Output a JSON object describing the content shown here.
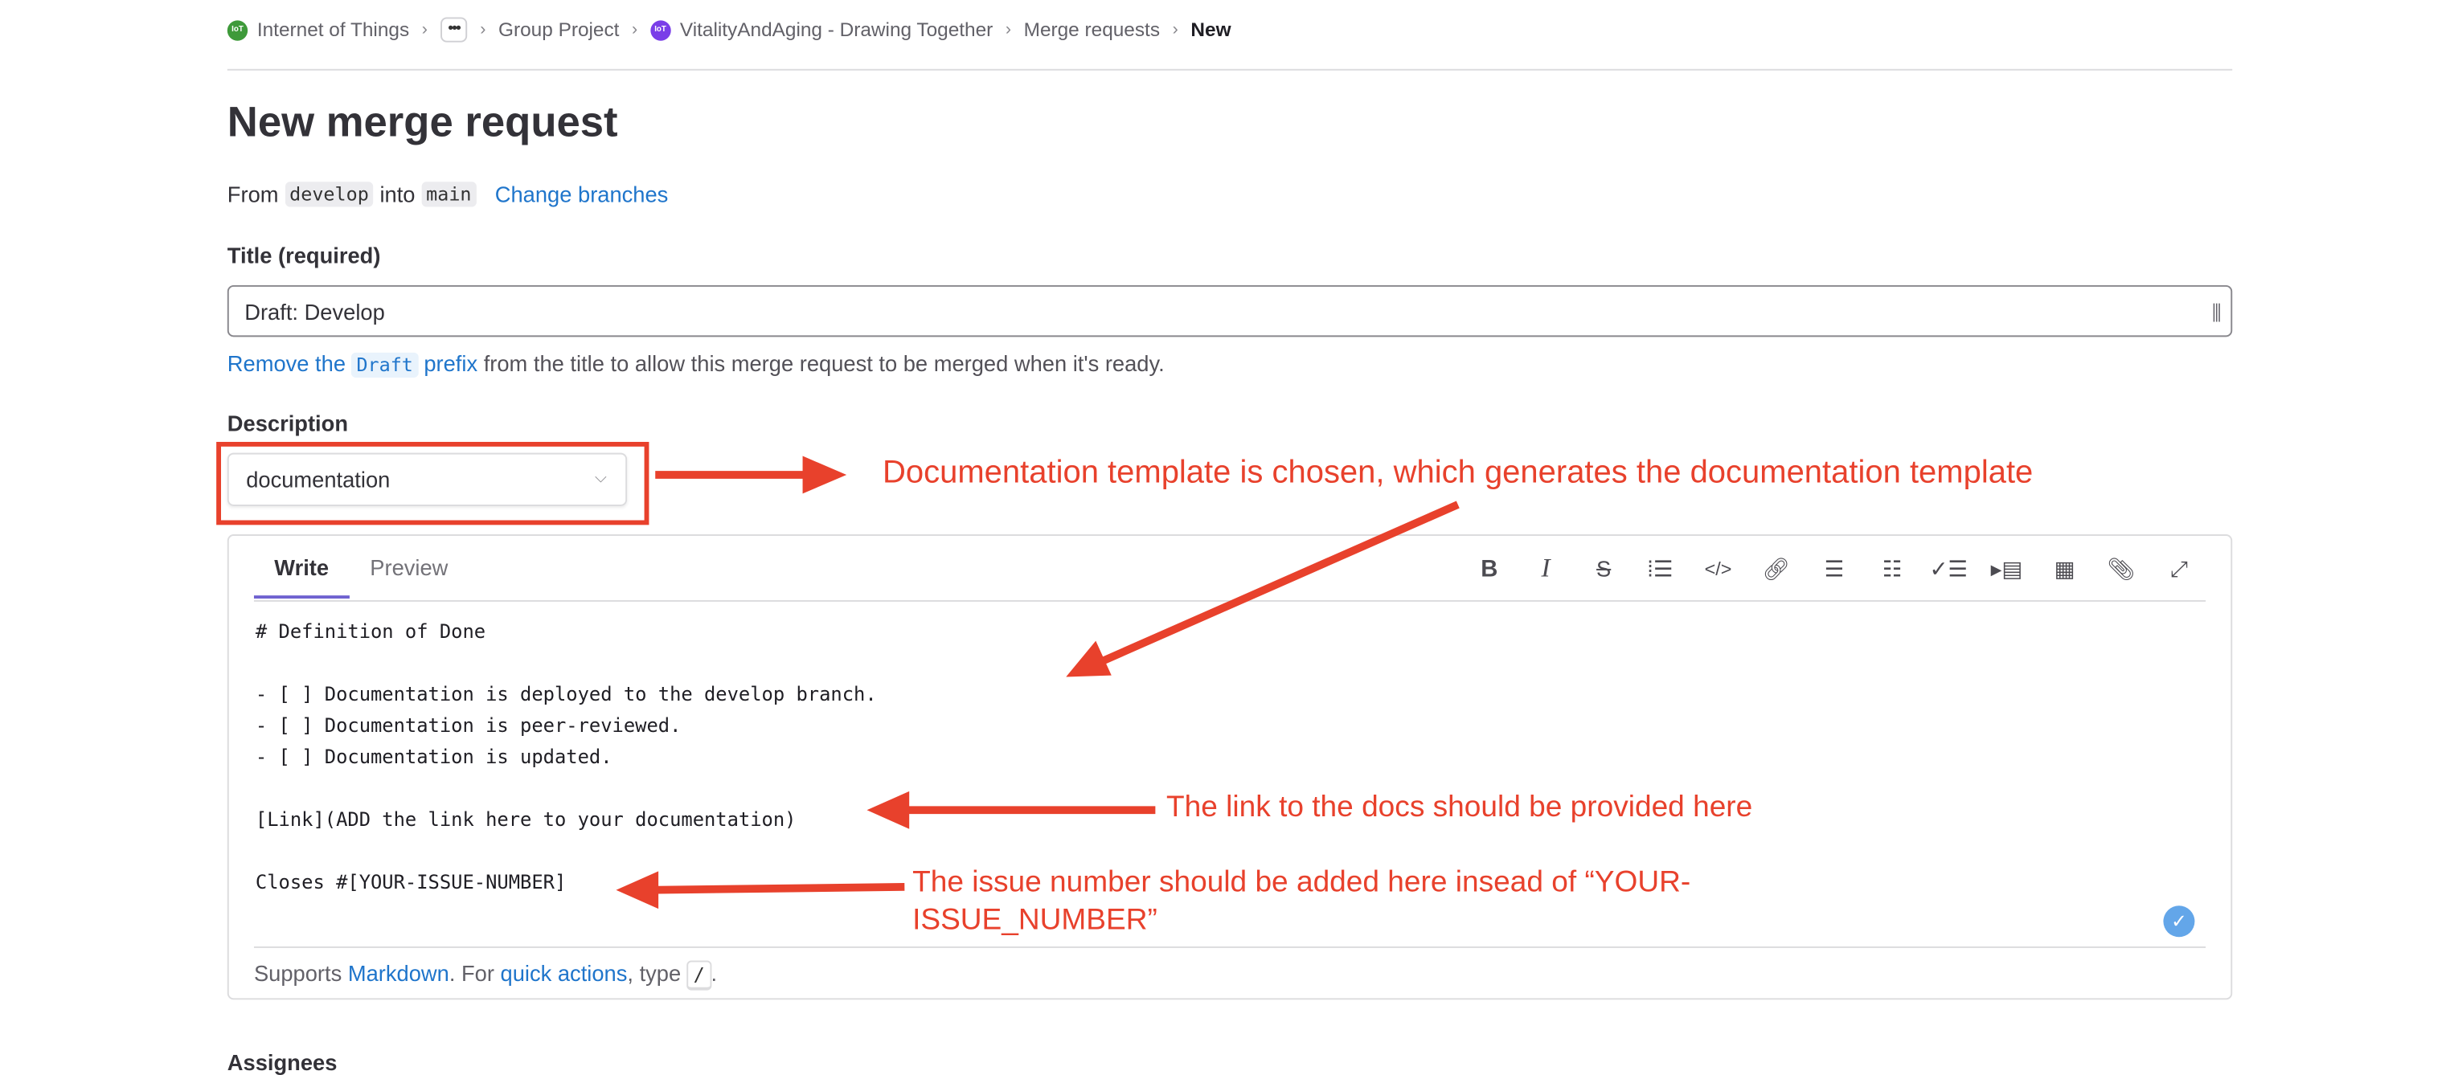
{
  "breadcrumb": {
    "items": [
      {
        "label": "Internet of Things",
        "avatar": "IoT",
        "avatar_color": "#3e9a3a"
      },
      {
        "label": "•••"
      },
      {
        "label": "Group Project"
      },
      {
        "label": "VitalityAndAging - Drawing Together",
        "avatar": "IoT",
        "avatar_color": "#7a3ee8"
      },
      {
        "label": "Merge requests"
      },
      {
        "label": "New"
      }
    ]
  },
  "page_title": "New merge request",
  "branches": {
    "from_label": "From",
    "source": "develop",
    "into_label": "into",
    "target": "main",
    "change_label": "Change branches"
  },
  "title_field": {
    "label": "Title (required)",
    "value": "Draft: Develop"
  },
  "draft_help": {
    "link_pre": "Remove the",
    "code": "Draft",
    "link_post": "prefix",
    "rest": "from the title to allow this merge request to be merged when it's ready."
  },
  "description": {
    "label": "Description",
    "template_select": "documentation",
    "tabs": [
      "Write",
      "Preview"
    ],
    "toolbar": [
      "bold-icon",
      "italic-icon",
      "strikethrough-icon",
      "quote-icon",
      "code-icon",
      "link-icon",
      "bullet-list-icon",
      "numbered-list-icon",
      "task-list-icon",
      "collapsible-icon",
      "table-icon",
      "attach-icon",
      "fullscreen-icon"
    ],
    "lines": [
      "# Definition of Done",
      "",
      "- [ ] Documentation is deployed to the develop branch.",
      "- [ ] Documentation is peer-reviewed.",
      "- [ ] Documentation is updated.",
      "",
      "[Link](ADD the link here to your documentation)",
      "",
      "Closes #[YOUR-ISSUE-NUMBER]"
    ],
    "footer": {
      "pre": "Supports",
      "markdown": "Markdown",
      "mid": ". For",
      "quick_actions": "quick actions",
      "post": ", type",
      "key": "/",
      "end": "."
    }
  },
  "annotations": {
    "template": "Documentation template is chosen, which generates the documentation template",
    "link": "The link to the docs should be provided here",
    "issue_line1": "The issue number should be added here insead of “YOUR-",
    "issue_line2": "ISSUE_NUMBER”",
    "color": "#e8412c"
  },
  "next_section_label": "Assignees"
}
